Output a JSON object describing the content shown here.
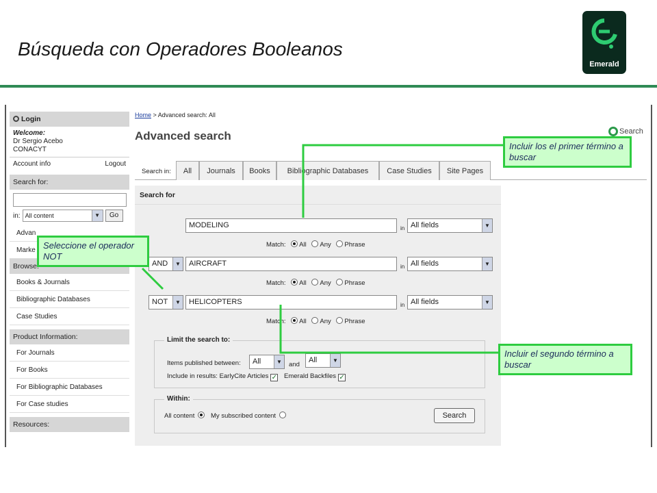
{
  "slide": {
    "title": "Búsqueda con Operadores Booleanos",
    "logo_text": "Emerald",
    "accent": "#2f8a55"
  },
  "sidebar": {
    "login_label": "Login",
    "welcome_label": "Welcome:",
    "user_name": "Dr Sergio Acebo",
    "org": "CONACYT",
    "account_info": "Account info",
    "logout": "Logout",
    "search_for_label": "Search for:",
    "search_value": "",
    "in_label": "in:",
    "content_select": "All content",
    "go_label": "Go",
    "advanced_partial": "Advan",
    "marked_partial": "Marke",
    "browse_label": "Browse:",
    "browse_items": [
      "Books & Journals",
      "Bibliographic Databases",
      "Case Studies"
    ],
    "product_label": "Product Information:",
    "product_items": [
      "For Journals",
      "For Books",
      "For Bibliographic Databases",
      "For Case studies"
    ],
    "resources_label": "Resources:"
  },
  "main": {
    "breadcrumb_home": "Home",
    "breadcrumb_rest": " > Advanced search: All",
    "heading": "Advanced search",
    "side_search": "Search",
    "search_in_label": "Search in:",
    "tabs": [
      "All",
      "Journals",
      "Books",
      "Bibliographic Databases",
      "Case Studies",
      "Site Pages"
    ],
    "form_heading": "Search for",
    "in_word": "in",
    "rows": [
      {
        "operator": "",
        "term": "MODELING",
        "field": "All fields"
      },
      {
        "operator": "AND",
        "term": "AIRCRAFT",
        "field": "All fields"
      },
      {
        "operator": "NOT",
        "term": "HELICOPTERS",
        "field": "All fields"
      }
    ],
    "match_label": "Match:",
    "match_options": [
      "All",
      "Any",
      "Phrase"
    ],
    "limit_heading": "Limit the search to:",
    "items_published_label": "Items published between:",
    "year_from": "All",
    "and_word": "and",
    "year_to": "All",
    "include_label": "Include in results: EarlyCite Articles",
    "backfiles_label": "Emerald Backfiles",
    "within_heading": "Within:",
    "within_all": "All content",
    "within_subscribed": "My subscribed content",
    "search_button": "Search"
  },
  "callouts": {
    "first_term": "Incluir los  el primer término a  buscar",
    "not_operator": "Seleccione el operador  NOT",
    "second_term": "Incluir  el segundo término a buscar",
    "color": "#2ecc40"
  }
}
